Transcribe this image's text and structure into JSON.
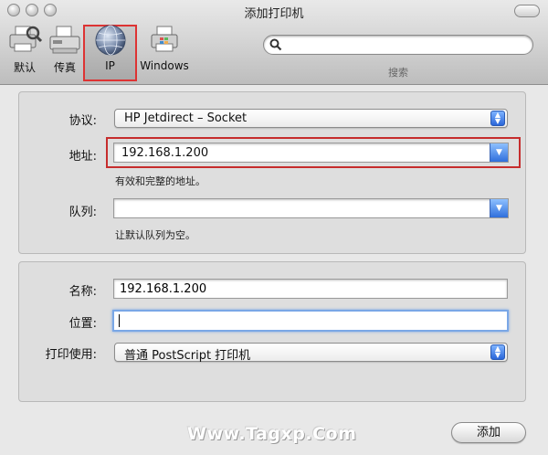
{
  "window": {
    "title": "添加打印机"
  },
  "toolbar": {
    "items": [
      {
        "label": "默认",
        "icon": "default-printer-icon"
      },
      {
        "label": "传真",
        "icon": "fax-icon"
      },
      {
        "label": "IP",
        "icon": "ip-globe-icon",
        "selected": true
      },
      {
        "label": "Windows",
        "icon": "windows-printer-icon"
      }
    ],
    "search_label": "搜索",
    "search_value": ""
  },
  "connection": {
    "protocol_label": "协议:",
    "protocol_value": "HP Jetdirect – Socket",
    "address_label": "地址:",
    "address_value": "192.168.1.200",
    "address_hint": "有效和完整的地址。",
    "queue_label": "队列:",
    "queue_value": "",
    "queue_hint": "让默认队列为空。"
  },
  "printer": {
    "name_label": "名称:",
    "name_value": "192.168.1.200",
    "location_label": "位置:",
    "location_value": "",
    "use_label": "打印使用:",
    "use_value": "普通 PostScript 打印机"
  },
  "footer": {
    "add_button": "添加"
  },
  "watermark": "Www.Tagxp.Com",
  "colors": {
    "accent": "#2f6fdc",
    "highlight_box": "#c62d2d",
    "focus_ring": "#7aa7e6"
  }
}
